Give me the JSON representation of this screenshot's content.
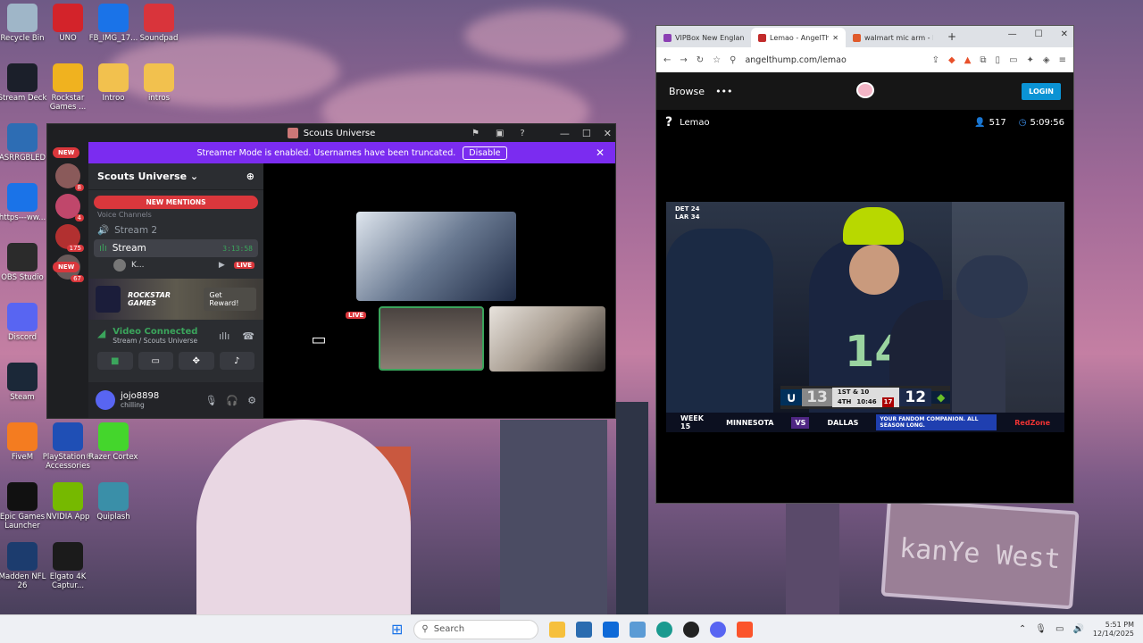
{
  "desktop": {
    "icons": [
      {
        "label": "Recycle Bin",
        "color": "#9fb6c8"
      },
      {
        "label": "UNO",
        "color": "#d3232a"
      },
      {
        "label": "FB_IMG_17...",
        "color": "#1a73e8"
      },
      {
        "label": "Soundpad",
        "color": "#d9343b"
      },
      {
        "label": "Stream Deck",
        "color": "#1b1f2a"
      },
      {
        "label": "Rockstar Games ...",
        "color": "#f0b21f"
      },
      {
        "label": "Introo",
        "color": "#f2c14e"
      },
      {
        "label": "intros",
        "color": "#f2c14e"
      },
      {
        "label": "ASRRGBLED",
        "color": "#2d6db4"
      },
      {
        "label": "https---ww...",
        "color": "#1a73e8"
      },
      {
        "label": "OBS Studio",
        "color": "#2b2b2b"
      },
      {
        "label": "Discord",
        "color": "#5865f2"
      },
      {
        "label": "Steam",
        "color": "#1b2838"
      },
      {
        "label": "FiveM",
        "color": "#f47c20"
      },
      {
        "label": "PlayStation® Accessories",
        "color": "#1f4fb5"
      },
      {
        "label": "Razer Cortex",
        "color": "#44d62c"
      },
      {
        "label": "Epic Games Launcher",
        "color": "#111111"
      },
      {
        "label": "NVIDIA App",
        "color": "#76b900"
      },
      {
        "label": "Quiplash",
        "color": "#3a8fa8"
      },
      {
        "label": "Madden NFL 26",
        "color": "#1c3c6e"
      },
      {
        "label": "Elgato 4K Captur...",
        "color": "#1b1b1b"
      }
    ],
    "wallpaper_sign": "kanYe West"
  },
  "discord": {
    "window_title": "Scouts Universe",
    "banner_text": "Streamer Mode is enabled. Usernames have been truncated.",
    "banner_button": "Disable",
    "server_name": "Scouts Universe",
    "new_label": "NEW",
    "new_mentions": "NEW MENTIONS",
    "rail_badges": [
      "8",
      "4",
      "175",
      "67"
    ],
    "category": "Voice Channels",
    "channels": [
      {
        "name": "Stream 2"
      },
      {
        "name": "Stream",
        "timer": "3:13:58"
      }
    ],
    "voice_user": "K...",
    "live_label": "LIVE",
    "promo_brand": "ROCKSTAR GAMES",
    "promo_button": "Get Reward!",
    "voice_status": "Video Connected",
    "voice_location": "Stream / Scouts Universe",
    "username": "jojo8898",
    "user_status": "chilling",
    "stage_live": "LIVE"
  },
  "browser": {
    "tabs": [
      {
        "title": "VIPBox New England",
        "color": "#8b3fb3"
      },
      {
        "title": "Lemao - AngelTh",
        "color": "#c22b2b"
      },
      {
        "title": "walmart mic arm - B",
        "color": "#e05a2b"
      }
    ],
    "url": "angelthump.com/lemao",
    "nav_browse": "Browse",
    "login_label": "LOGIN",
    "stream_title": "Lemao",
    "viewers": "517",
    "uptime": "5:09:56",
    "scoreboard": {
      "left_score": "13",
      "down": "1ST & 10",
      "quarter": "4TH",
      "clock": "10:46",
      "play_clock": "17",
      "right_score": "12"
    },
    "ticker": {
      "week": "WEEK 15",
      "team_a": "MINNESOTA",
      "vs": "VS",
      "team_b": "DALLAS",
      "promo": "YOUR FANDOM COMPANION. ALL SEASON LONG.",
      "redzone": "RedZone"
    },
    "side_scores": [
      "DET 24",
      "LAR 34"
    ],
    "jersey_number": "14"
  },
  "taskbar": {
    "search_placeholder": "Search",
    "time": "5:51 PM",
    "date": "12/14/2025"
  }
}
